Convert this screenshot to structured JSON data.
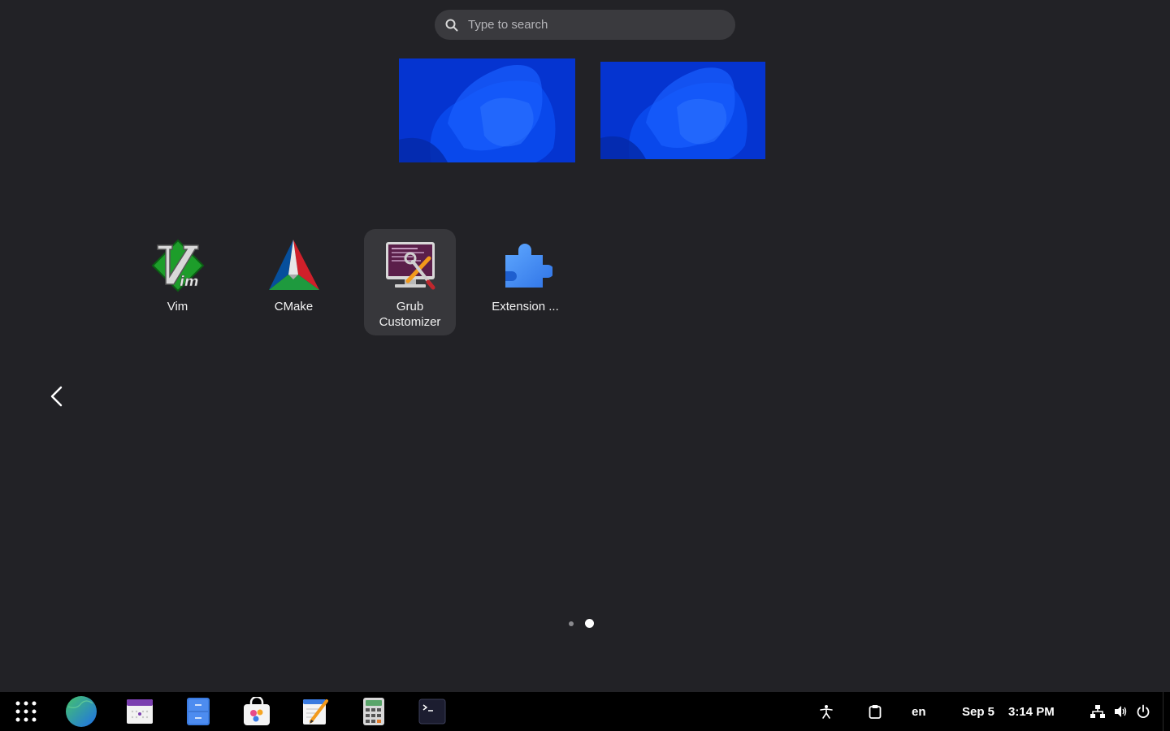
{
  "search": {
    "placeholder": "Type to search"
  },
  "apps": [
    {
      "label": "Vim",
      "icon": "vim-icon"
    },
    {
      "label": "CMake",
      "icon": "cmake-icon"
    },
    {
      "label": "Grub Customizer",
      "icon": "grub-customizer-icon",
      "selected": true
    },
    {
      "label": "Extension ...",
      "icon": "extension-manager-icon"
    }
  ],
  "pager": {
    "pages": 2,
    "current": 2
  },
  "taskbar": {
    "pinned": [
      "app-grid-icon",
      "web-browser-icon",
      "calendar-icon",
      "file-manager-icon",
      "software-store-icon",
      "text-editor-icon",
      "calculator-icon",
      "terminal-icon"
    ],
    "keyboard_layout": "en",
    "date": "Sep 5",
    "time": "3:14 PM",
    "tray": [
      "accessibility-icon",
      "clipboard-icon",
      "network-icon",
      "volume-icon",
      "power-icon"
    ]
  },
  "colors": {
    "background": "#222226",
    "panel": "#000000",
    "accent": "#0637d6"
  }
}
